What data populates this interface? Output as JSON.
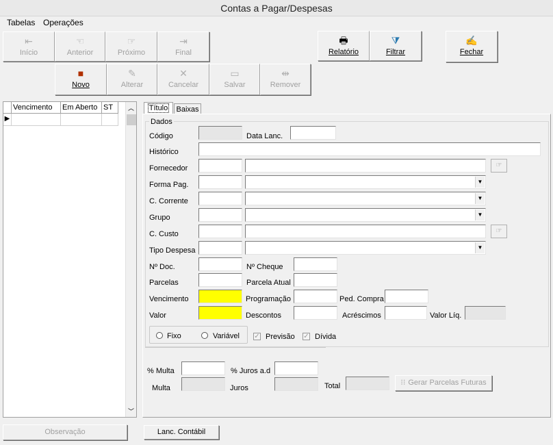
{
  "window": {
    "title": "Contas a Pagar/Despesas"
  },
  "menu": [
    "Tabelas",
    "Operações"
  ],
  "nav": {
    "inicio": "Início",
    "anterior": "Anterior",
    "proximo": "Próximo",
    "final": "Final",
    "novo": "Novo",
    "alterar": "Alterar",
    "cancelar": "Cancelar",
    "salvar": "Salvar",
    "remover": "Remover"
  },
  "actions": {
    "relatorio": "Relatório",
    "filtrar": "Filtrar",
    "fechar": "Fechar"
  },
  "grid": {
    "columns": [
      "Vencimento",
      "Em Aberto",
      "ST"
    ]
  },
  "tabs": [
    "Título",
    "Baixas"
  ],
  "form": {
    "group_title": "Dados",
    "codigo": "Código",
    "data_lanc": "Data Lanc.",
    "historico": "Histórico",
    "fornecedor": "Fornecedor",
    "forma_pag": "Forma Pag.",
    "c_corrente": "C. Corrente",
    "grupo": "Grupo",
    "c_custo": "C. Custo",
    "tipo_despesa": "Tipo Despesa",
    "n_doc": "Nº Doc.",
    "n_cheque": "Nº Cheque",
    "parcelas": "Parcelas",
    "parcela_atual": "Parcela Atual",
    "vencimento": "Vencimento",
    "programacao": "Programação",
    "ped_compra": "Ped. Compra",
    "valor": "Valor",
    "descontos": "Descontos",
    "acrescimos": "Acréscimos",
    "valor_liq": "Valor Líq.",
    "fixo": "Fixo",
    "variavel": "Variável",
    "previsao": "Previsão",
    "divida": "Dívida",
    "pct_multa": "% Multa",
    "pct_juros": "% Juros a.d",
    "multa": "Multa",
    "juros": "Juros",
    "total": "Total",
    "gerar_parcelas": "Gerar Parcelas Futuras"
  },
  "bottom": {
    "observacao": "Observação",
    "lanc_contabil": "Lanc. Contábil"
  },
  "colors": {
    "required_field": "#ffff00"
  }
}
